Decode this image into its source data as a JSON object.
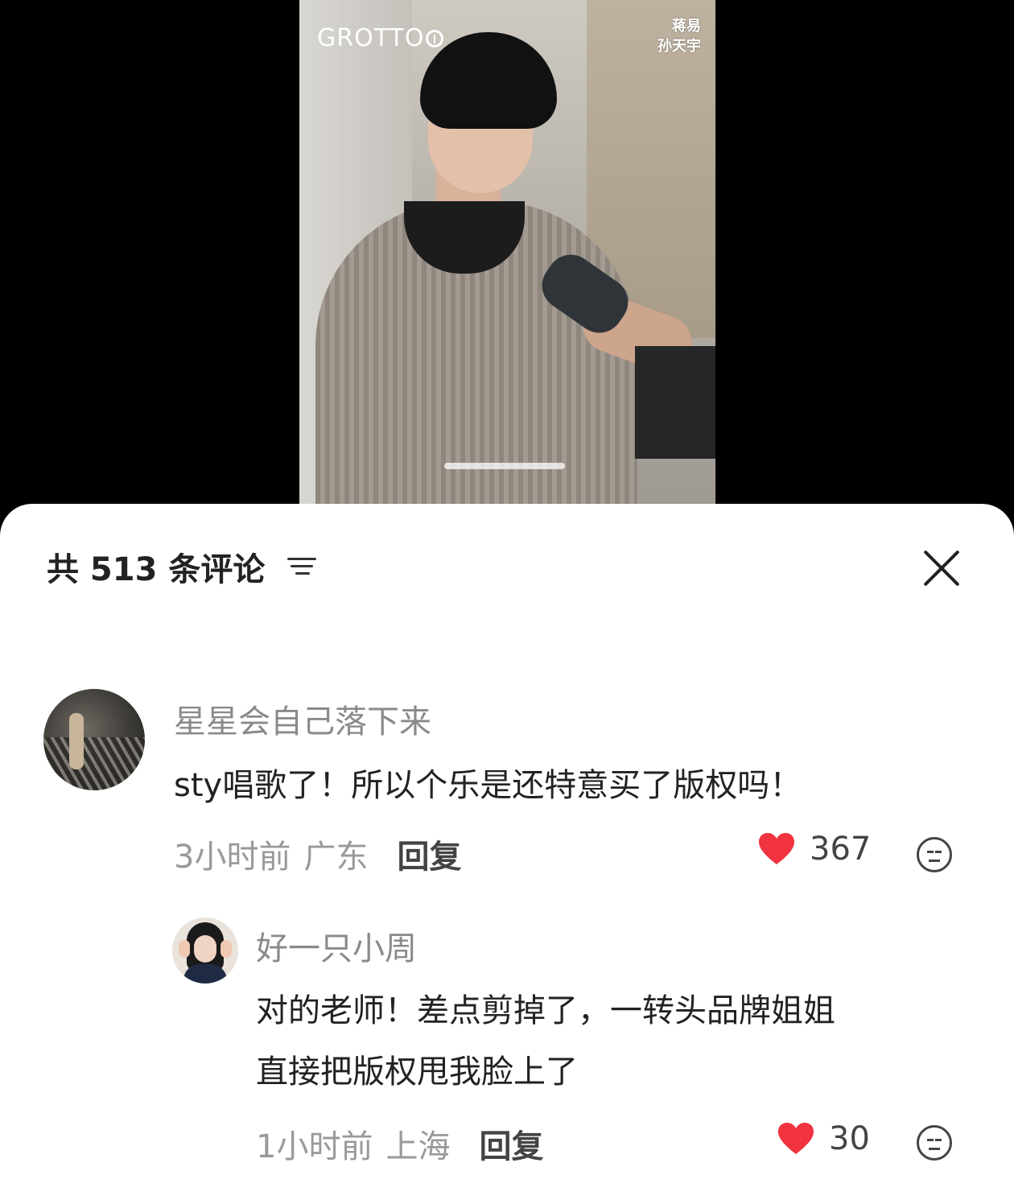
{
  "video": {
    "brand_logo": "GROTTO",
    "credit_lines": [
      "蒋易",
      "孙天宇"
    ]
  },
  "comments_header": {
    "title": "共 513 条评论",
    "sort_icon": "sort-lines-icon",
    "close_icon": "close-icon"
  },
  "comments": [
    {
      "username": "星星会自己落下来",
      "text": "sty唱歌了！所以个乐是还特意买了版权吗！",
      "time": "3小时前",
      "location": "广东",
      "reply_label": "回复",
      "likes": "367",
      "liked": true
    },
    {
      "username": "好一只小周",
      "text_lines": [
        "对的老师！差点剪掉了，一转头品牌姐姐",
        "直接把版权甩我脸上了"
      ],
      "time": "1小时前",
      "location": "上海",
      "reply_label": "回复",
      "likes": "30",
      "liked": true
    }
  ],
  "colors": {
    "heart": "#f0333f",
    "username": "#8a8a8a",
    "text": "#222222",
    "meta": "#999999"
  }
}
